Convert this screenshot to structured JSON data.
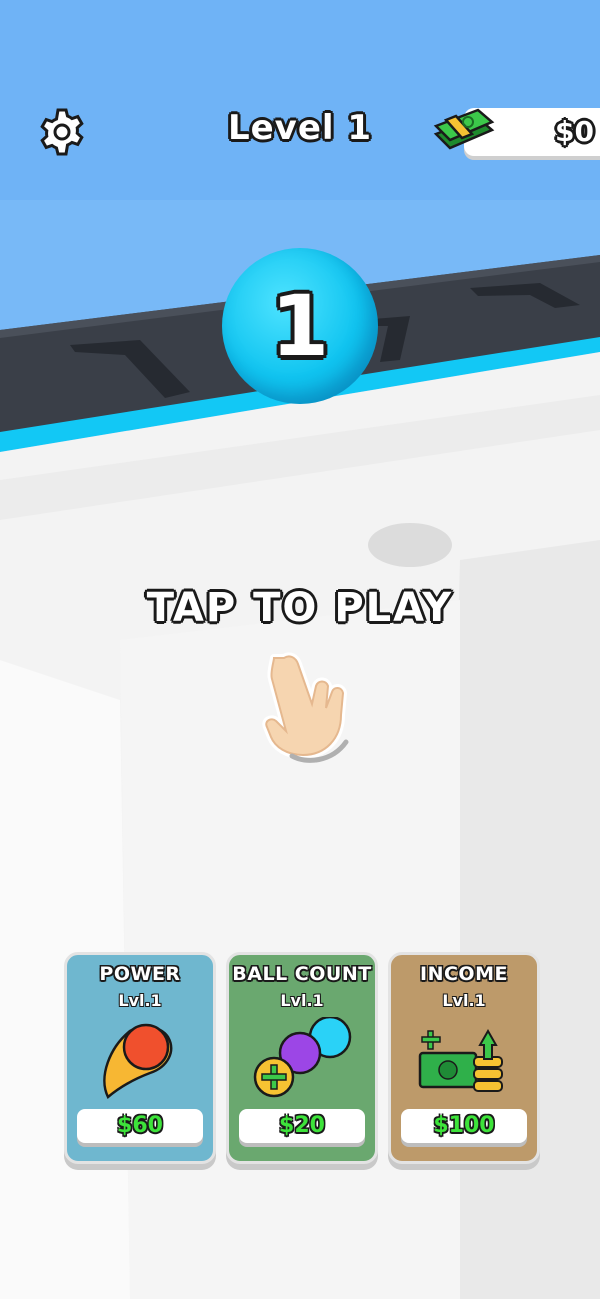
{
  "colors": {
    "sky": "#78b9f7",
    "track": "#3a3f48",
    "track_edge": "#12c8f5",
    "floor": "#f2f2f2",
    "ball": "#10c4f0",
    "card_power": "#6fb7cf",
    "card_ball_count": "#6aa86f",
    "card_income": "#bd9a6a",
    "price_green": "#3de33a"
  },
  "hud": {
    "settings_icon": "gear-icon",
    "level_label": "Level 1",
    "money_value": "$0",
    "money_icon": "cash-stack-icon"
  },
  "ball": {
    "number": "1"
  },
  "prompt": {
    "text": "TAP TO PLAY",
    "icon": "tap-hand-icon"
  },
  "upgrades": [
    {
      "title": "POWER",
      "level": "Lvl.1",
      "price": "$60",
      "icon": "fireball-icon"
    },
    {
      "title": "BALL COUNT",
      "level": "Lvl.1",
      "price": "$20",
      "icon": "add-balls-icon"
    },
    {
      "title": "INCOME",
      "level": "Lvl.1",
      "price": "$100",
      "icon": "income-cash-icon"
    }
  ]
}
